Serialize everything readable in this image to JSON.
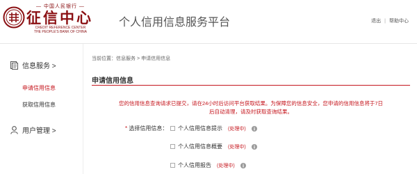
{
  "header": {
    "logo_pboc": "— 中国人民银行 —",
    "logo_name": "征信中心",
    "logo_en_line1": "CREDIT REFERENCE CENTER",
    "logo_en_line2": "THE PEOPLE'S BANK OF CHINA",
    "site_title": "个人信用信息服务平台",
    "logout_label": "退出",
    "separator": "|",
    "help_label": "帮助中心"
  },
  "sidebar": {
    "groups": [
      {
        "label": "信息服务 >",
        "icon": "document-icon"
      },
      {
        "label": "用户管理 >",
        "icon": "user-icon"
      }
    ],
    "items": [
      {
        "label": "申请信用信息",
        "active": true
      },
      {
        "label": "获取信用信息",
        "active": false
      }
    ]
  },
  "main": {
    "breadcrumb": {
      "prefix": "当前位置：",
      "level1": "信息服务",
      "arrow": ">",
      "level2": "申请信用信息"
    },
    "section_title": "申请信用信息",
    "notice_line1": "您的信用信息查询请求已提交，请在24小时后访问平台获取结果。为保障您的信息安全，您申请的信用信息将于7日",
    "notice_line2": "后自动清理，请及时获取查询结果。",
    "form": {
      "required_mark": "*",
      "label": "选择信用信息：",
      "options": [
        {
          "label": "个人信用信息提示",
          "status": "(处理中)"
        },
        {
          "label": "个人信用信息概要",
          "status": "(处理中)"
        },
        {
          "label": "个人信用报告",
          "status": "(处理中)"
        }
      ]
    }
  },
  "colors": {
    "brand_red": "#c5161d",
    "logo_red": "#8a0f12",
    "info_icon": "#9a9a9a"
  }
}
